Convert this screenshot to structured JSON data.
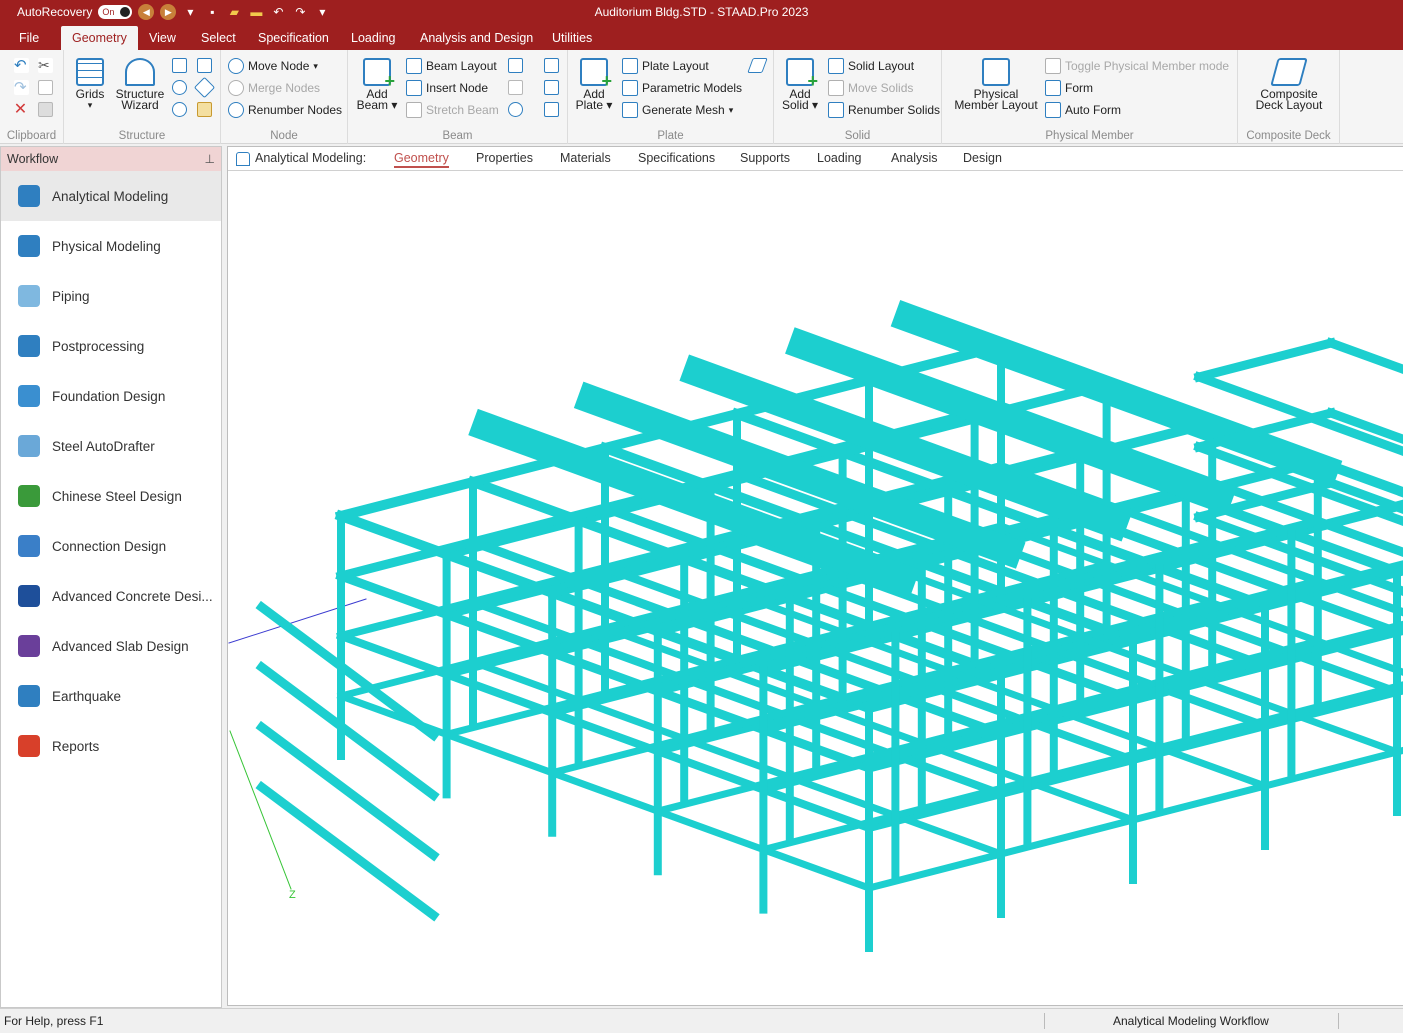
{
  "titlebar": {
    "autorecovery_label": "AutoRecovery",
    "toggle_state": "On",
    "title": "Auditorium Bldg.STD - STAAD.Pro 2023"
  },
  "menu": {
    "tabs": [
      "File",
      "Geometry",
      "View",
      "Select",
      "Specification",
      "Loading",
      "Analysis and Design",
      "Utilities"
    ],
    "active": "Geometry"
  },
  "ribbon": {
    "clipboard": {
      "label": "Clipboard"
    },
    "structure": {
      "label": "Structure",
      "grids": "Grids",
      "wizard_line1": "Structure",
      "wizard_line2": "Wizard"
    },
    "node": {
      "label": "Node",
      "move": "Move Node",
      "merge": "Merge Nodes",
      "renumber": "Renumber Nodes"
    },
    "beam": {
      "label": "Beam",
      "add_line1": "Add",
      "add_line2": "Beam",
      "layout": "Beam Layout",
      "insert": "Insert Node",
      "stretch": "Stretch Beam"
    },
    "plate": {
      "label": "Plate",
      "add_line1": "Add",
      "add_line2": "Plate",
      "layout": "Plate Layout",
      "parametric": "Parametric Models",
      "mesh": "Generate Mesh"
    },
    "solid": {
      "label": "Solid",
      "add_line1": "Add",
      "add_line2": "Solid",
      "layout": "Solid Layout",
      "move": "Move Solids",
      "renumber": "Renumber Solids"
    },
    "physical": {
      "label": "Physical Member",
      "layout_line1": "Physical",
      "layout_line2": "Member Layout",
      "toggle": "Toggle Physical Member mode",
      "form": "Form",
      "auto_form": "Auto Form"
    },
    "deck": {
      "label": "Composite Deck",
      "line1": "Composite",
      "line2": "Deck Layout"
    }
  },
  "workflow": {
    "title": "Workflow",
    "items": [
      {
        "label": "Analytical Modeling",
        "icon": "analytical-modeling-icon",
        "color": "#2f7fc0"
      },
      {
        "label": "Physical Modeling",
        "icon": "physical-modeling-icon",
        "color": "#2f7fc0"
      },
      {
        "label": "Piping",
        "icon": "piping-icon",
        "color": "#7fb8e0"
      },
      {
        "label": "Postprocessing",
        "icon": "postprocessing-icon",
        "color": "#2f7fc0"
      },
      {
        "label": "Foundation Design",
        "icon": "foundation-design-icon",
        "color": "#3a8fd0"
      },
      {
        "label": "Steel AutoDrafter",
        "icon": "steel-autodrafter-icon",
        "color": "#6aa8d8"
      },
      {
        "label": "Chinese Steel Design",
        "icon": "chinese-steel-design-icon",
        "color": "#3a9a3a"
      },
      {
        "label": "Connection Design",
        "icon": "connection-design-icon",
        "color": "#3a7fc8"
      },
      {
        "label": "Advanced Concrete Desi...",
        "icon": "advanced-concrete-design-icon",
        "color": "#1e4f9a"
      },
      {
        "label": "Advanced Slab Design",
        "icon": "advanced-slab-design-icon",
        "color": "#6a3f9a"
      },
      {
        "label": "Earthquake",
        "icon": "earthquake-icon",
        "color": "#2f7fc0"
      },
      {
        "label": "Reports",
        "icon": "reports-icon",
        "color": "#d8402a"
      }
    ]
  },
  "viewport": {
    "mode_label": "Analytical Modeling:",
    "tabs": [
      "Geometry",
      "Properties",
      "Materials",
      "Specifications",
      "Supports",
      "Loading",
      "Analysis",
      "Design"
    ],
    "active_tab": "Geometry",
    "axis_z_label": "Z",
    "member_color": "#1ccfcf"
  },
  "statusbar": {
    "help": "For Help, press F1",
    "workflow": "Analytical Modeling Workflow"
  }
}
